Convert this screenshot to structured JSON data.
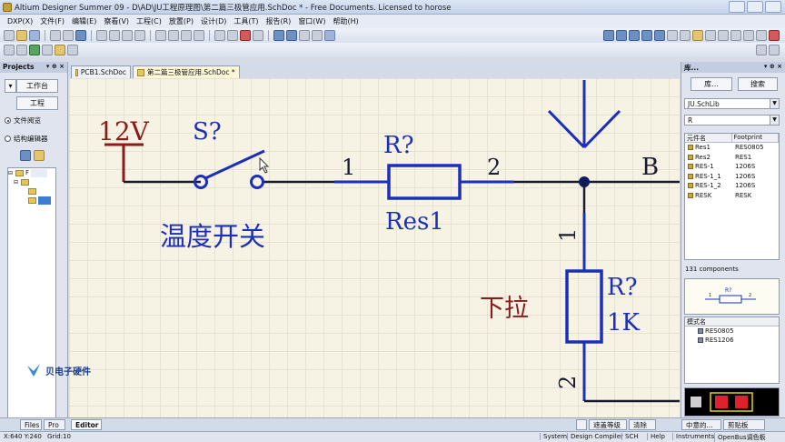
{
  "window": {
    "title": "Altium Designer Summer 09 - D\\AD\\JU工程原理图\\第二篇三极管应用.SchDoc * - Free Documents. Licensed to horose"
  },
  "menu": [
    "DXP(X)",
    "文件(F)",
    "编辑(E)",
    "察看(V)",
    "工程(C)",
    "放置(P)",
    "设计(D)",
    "工具(T)",
    "报告(R)",
    "窗口(W)",
    "帮助(H)"
  ],
  "left_panel": {
    "title": "Projects",
    "workspace_button": "工作台",
    "project_button": "工程",
    "radio_file_view": "文件阅览",
    "radio_structure": "结构编辑器",
    "tree_root": "F"
  },
  "doc_tabs": [
    {
      "label": "PCB1.SchDoc",
      "active": false
    },
    {
      "label": "第二篇三极管应用.SchDoc *",
      "active": true
    }
  ],
  "schematic": {
    "power_label": "12V",
    "switch_designator": "S?",
    "switch_comment": "温度开关",
    "r1_designator": "R?",
    "r1_comment": "Res1",
    "r1_pin1": "1",
    "r1_pin2": "2",
    "net_label_b": "B",
    "r2_designator": "R?",
    "r2_value": "1K",
    "r2_pin1": "1",
    "r2_pin2": "2",
    "pulldown_label": "下拉"
  },
  "right_panel": {
    "title": "库...",
    "library_button": "库...",
    "search_button": "搜索",
    "library_selected": "JU.SchLib",
    "filter_value": "R",
    "col_component": "元件名",
    "col_footprint": "Footprint",
    "components": [
      {
        "name": "Res1",
        "footprint": "RES0805"
      },
      {
        "name": "Res2",
        "footprint": "RES1"
      },
      {
        "name": "RES-1",
        "footprint": "1206S"
      },
      {
        "name": "RES-1_1",
        "footprint": "1206S"
      },
      {
        "name": "RES-1_2",
        "footprint": "1206S"
      },
      {
        "name": "RESK",
        "footprint": "RESK"
      }
    ],
    "component_count": "131 components",
    "preview_designator": "R?",
    "preview_pin1": "1",
    "preview_pin2": "2",
    "model_header": "模式名",
    "models": [
      "RES0805",
      "RES1206"
    ]
  },
  "bottom_tabs": {
    "files": "Files",
    "projects_short": "Pro",
    "editor": "Editor",
    "right": [
      "遮盖等级",
      "清除",
      "中意的...",
      "剪贴板"
    ]
  },
  "status": {
    "coords": "X:640 Y:240",
    "grid": "Grid:10",
    "buttons": [
      "System",
      "Design Compiler",
      "SCH",
      "Help",
      "Instruments",
      "OpenBus调色板"
    ]
  },
  "watermark": "贝电子硬件",
  "colors": {
    "wire": "#1a1a2e",
    "component": "#1c2fb8",
    "power": "#8b1a1a",
    "junction": "#0d1a66",
    "canvas": "#f6f3e4"
  }
}
